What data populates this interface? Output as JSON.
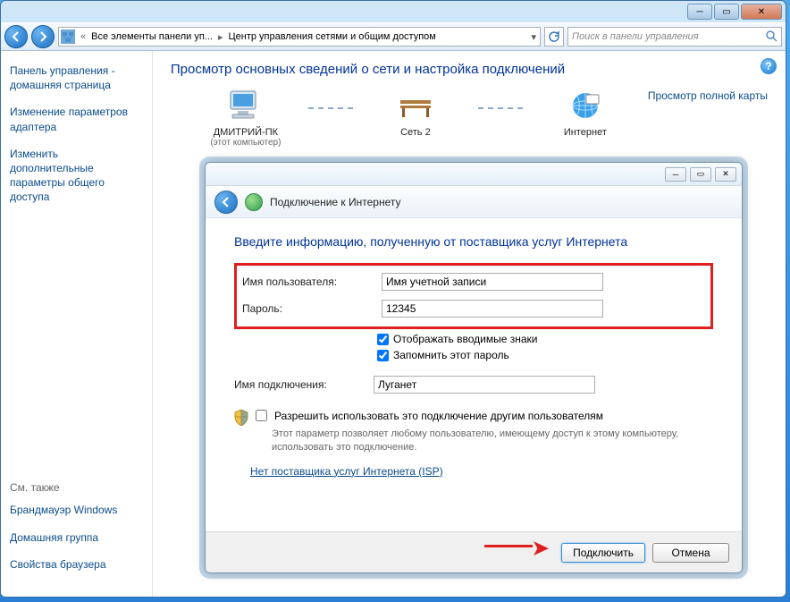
{
  "window": {
    "breadcrumb_icon": "network-icon",
    "breadcrumb_part1": "Все элементы панели уп...",
    "breadcrumb_part2": "Центр управления сетями и общим доступом",
    "search_placeholder": "Поиск в панели управления"
  },
  "sidebar": {
    "home": "Панель управления - домашняя страница",
    "adapter": "Изменение параметров адаптера",
    "sharing": "Изменить дополнительные параметры общего доступа",
    "seealso_title": "См. также",
    "seealso": [
      "Брандмауэр Windows",
      "Домашняя группа",
      "Свойства браузера"
    ]
  },
  "content": {
    "title": "Просмотр основных сведений о сети и настройка подключений",
    "view_map": "Просмотр полной карты",
    "node_pc": "ДМИТРИЙ-ПК",
    "node_pc_sub": "(этот компьютер)",
    "node_net": "Сеть 2",
    "node_internet": "Интернет"
  },
  "dialog": {
    "title": "Подключение к Интернету",
    "heading": "Введите информацию, полученную от поставщика услуг Интернета",
    "username_label": "Имя пользователя:",
    "username_value": "Имя учетной записи",
    "password_label": "Пароль:",
    "password_value": "12345",
    "show_chars": "Отображать вводимые знаки",
    "remember": "Запомнить этот пароль",
    "connection_name_label": "Имя подключения:",
    "connection_name_value": "Луганет",
    "allow_others": "Разрешить использовать это подключение другим пользователям",
    "allow_others_desc": "Этот параметр позволяет любому пользователю, имеющему доступ к этому компьютеру, использовать это подключение.",
    "no_isp": "Нет поставщика услуг Интернета (ISP)",
    "connect_btn": "Подключить",
    "cancel_btn": "Отмена"
  }
}
